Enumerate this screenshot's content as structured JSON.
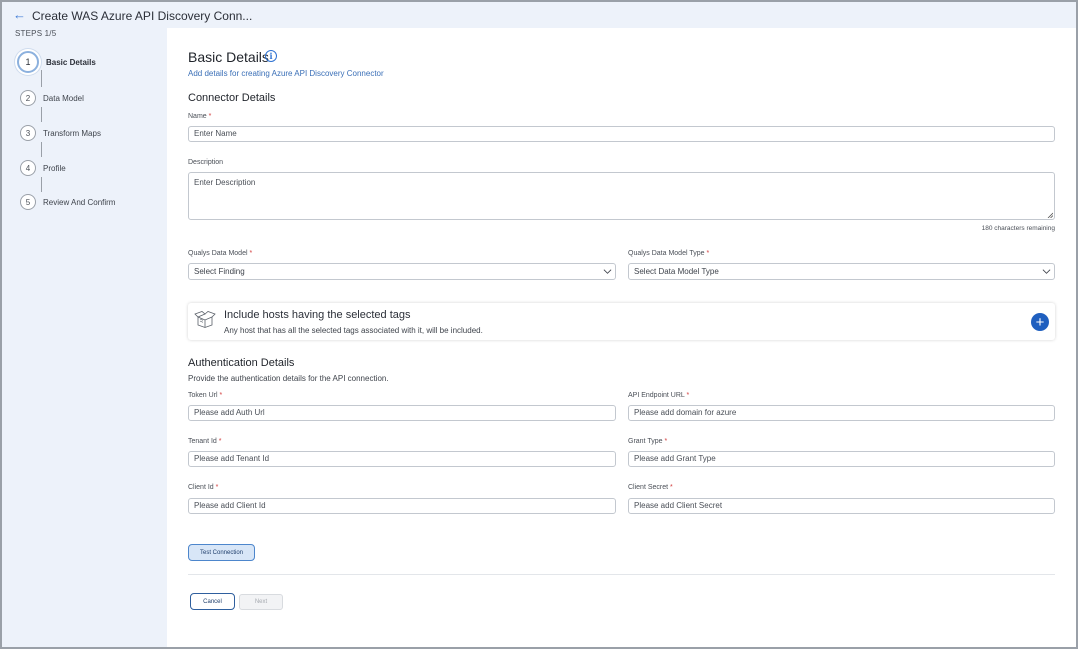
{
  "header": {
    "back_icon": "arrow-left-icon",
    "title": "Create WAS Azure API Discovery Conn..."
  },
  "sidebar": {
    "steps_label": "STEPS 1/5",
    "steps": [
      {
        "num": "1",
        "label": "Basic Details",
        "active": true
      },
      {
        "num": "2",
        "label": "Data Model",
        "active": false
      },
      {
        "num": "3",
        "label": "Transform Maps",
        "active": false
      },
      {
        "num": "4",
        "label": "Profile",
        "active": false
      },
      {
        "num": "5",
        "label": "Review And Confirm",
        "active": false
      }
    ]
  },
  "main": {
    "title": "Basic Details",
    "info_icon": "info-icon",
    "subtitle": "Add details for creating Azure API Discovery Connector",
    "connector_heading": "Connector Details",
    "name_label": "Name",
    "name_placeholder": "Enter Name",
    "description_label": "Description",
    "description_placeholder": "Enter Description",
    "char_counter": "180 characters remaining",
    "data_model_label": "Qualys Data Model",
    "data_model_value": "Select Finding",
    "data_model_type_label": "Qualys Data Model Type",
    "data_model_type_value": "Select Data Model Type",
    "required_mark": "*",
    "tags": {
      "icon": "open-box-icon",
      "title": "Include hosts having the selected tags",
      "subtitle": "Any host that has all the selected tags associated with it, will be included.",
      "add_icon": "plus-icon"
    },
    "auth_heading": "Authentication Details",
    "auth_subtitle": "Provide the authentication details for the API connection.",
    "token_url_label": "Token Url",
    "token_url_placeholder": "Please add Auth Url",
    "api_endpoint_label": "API Endpoint URL",
    "api_endpoint_placeholder": "Please add domain for azure",
    "tenant_id_label": "Tenant Id",
    "tenant_id_placeholder": "Please add Tenant Id",
    "grant_type_label": "Grant Type",
    "grant_type_placeholder": "Please add Grant Type",
    "client_id_label": "Client Id",
    "client_id_placeholder": "Please add Client Id",
    "client_secret_label": "Client Secret",
    "client_secret_placeholder": "Please add Client Secret",
    "test_connection": "Test Connection",
    "cancel": "Cancel",
    "next": "Next"
  },
  "colors": {
    "accent": "#1f5fbf",
    "sidebar_bg": "#edf2fa",
    "required": "#d23b3b"
  }
}
